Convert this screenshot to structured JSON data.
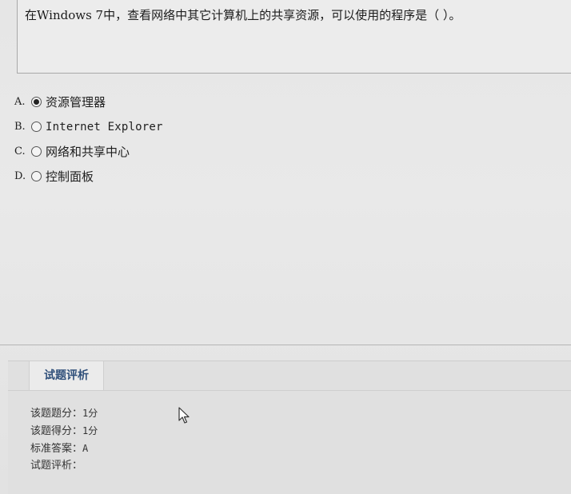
{
  "question": {
    "text": "在Windows 7中，查看网络中其它计算机上的共享资源，可以使用的程序是（  ）。"
  },
  "options": [
    {
      "letter": "A.",
      "label": "资源管理器",
      "selected": true
    },
    {
      "letter": "B.",
      "label": "Internet Explorer",
      "selected": false
    },
    {
      "letter": "C.",
      "label": "网络和共享中心",
      "selected": false
    },
    {
      "letter": "D.",
      "label": "控制面板",
      "selected": false
    }
  ],
  "analysis": {
    "tab_label": "试题评析",
    "score_label": "该题题分：",
    "score_value": "1分",
    "earned_label": "该题得分：",
    "earned_value": "1分",
    "answer_label": "标准答案：",
    "answer_value": "A",
    "comment_label": "试题评析：",
    "tab_color": "#2f4f7a"
  },
  "icons": {
    "radio_checked": "radio-checked-icon",
    "radio_unchecked": "radio-unchecked-icon",
    "cursor": "mouse-pointer-icon"
  }
}
